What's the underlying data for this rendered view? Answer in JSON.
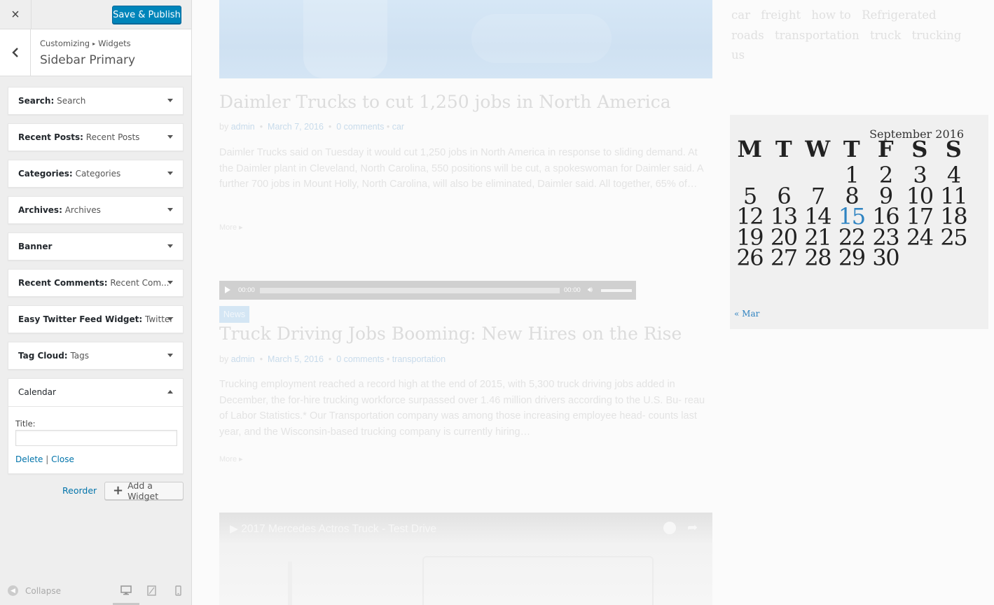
{
  "customizer": {
    "save_label": "Save & Publish",
    "close_icon": "×",
    "breadcrumb": {
      "root": "Customizing",
      "separator": "▸",
      "current": "Widgets"
    },
    "section_title": "Sidebar Primary",
    "widgets": [
      {
        "name": "Search:",
        "title": "Search"
      },
      {
        "name": "Recent Posts:",
        "title": "Recent Posts"
      },
      {
        "name": "Categories:",
        "title": "Categories"
      },
      {
        "name": "Archives:",
        "title": "Archives"
      },
      {
        "name": "Banner",
        "title": ""
      },
      {
        "name": "Recent Comments:",
        "title": "Recent Com..."
      },
      {
        "name": "Easy Twitter Feed Widget:",
        "title": "Twitter"
      },
      {
        "name": "Tag Cloud:",
        "title": "Tags"
      }
    ],
    "calendar_widget": {
      "name": "Calendar",
      "title_label": "Title:",
      "title_value": "",
      "delete_label": "Delete",
      "separator": "|",
      "close_label": "Close"
    },
    "reorder_label": "Reorder",
    "add_widget_label": "Add a Widget",
    "collapse_label": "Collapse",
    "preview_device_selected": "desktop",
    "accent_color": "#0085ba"
  },
  "preview": {
    "posts": [
      {
        "title": "Daimler Trucks to cut 1,250 jobs in North America",
        "by": "by",
        "author": "admin",
        "dot": "•",
        "date": "March 7, 2016",
        "comments": "0 comments",
        "category": "car",
        "excerpt": "Daimler Trucks said on Tuesday it would cut 1,250 jobs in North America in response to sliding demand. At the Daimler plant in Cleveland, North Carolina, 550 positions will be cut, a spokeswoman for Daimler said. A further 700 jobs in Mount Holly, North Carolina, will also be eliminated, Daimler said. All together, 65% of…",
        "more": "More  ▸"
      },
      {
        "badge": "News",
        "title": "Truck Driving Jobs Booming: New Hires on the Rise",
        "by": "by",
        "author": "admin",
        "dot": "•",
        "date": "March 5, 2016",
        "comments": "0 comments",
        "category": "transportation",
        "excerpt": "Trucking employment reached a record high at the end of 2015, with 5,300 truck driving jobs added in December, the for-hire trucking workforce surpassed over 1.46 million drivers according to the U.S. Bu- reau of Labor Statistics.* Our Transportation company was among those increasing employee head- counts last year, and the Wisconsin-based trucking company is currently hiring…",
        "more": "More  ▸"
      }
    ],
    "audio": {
      "current": "00:00",
      "duration": "00:00"
    },
    "video": {
      "title": "▶ 2017 Mercedes Actros Truck - Test Drive"
    },
    "tags": [
      "car",
      "freight",
      "how to",
      "Refrigerated",
      "roads",
      "transportation",
      "truck",
      "trucking",
      "us"
    ],
    "calendar": {
      "caption": "September 2016",
      "weekdays": [
        "M",
        "T",
        "W",
        "T",
        "F",
        "S",
        "S"
      ],
      "weeks": [
        [
          "",
          "",
          "",
          "1",
          "2",
          "3",
          "4"
        ],
        [
          "5",
          "6",
          "7",
          "8",
          "9",
          "10",
          "11"
        ],
        [
          "12",
          "13",
          "14",
          "15",
          "16",
          "17",
          "18"
        ],
        [
          "19",
          "20",
          "21",
          "22",
          "23",
          "24",
          "25"
        ],
        [
          "26",
          "27",
          "28",
          "29",
          "30",
          "",
          ""
        ]
      ],
      "today": "15",
      "prev_link": "« Mar"
    }
  }
}
